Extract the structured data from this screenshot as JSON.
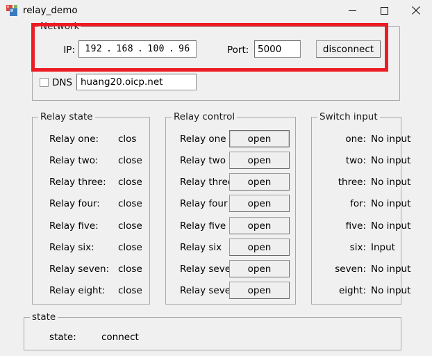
{
  "window": {
    "title": "relay_demo",
    "icon": "app-icon",
    "controls": {
      "minimize": "minimize-icon",
      "maximize": "maximize-icon",
      "close": "close-icon"
    }
  },
  "highlight": {
    "color": "#ed1c24"
  },
  "network": {
    "title": "Network",
    "ip_label": "IP:",
    "ip_octets": [
      "192",
      "168",
      "100",
      "96"
    ],
    "ip_separator": ".",
    "ip_value": "192.168.100.96",
    "port_label": "Port:",
    "port_value": "5000",
    "connect_button": "disconnect",
    "dns_label": "DNS",
    "dns_checked": false,
    "dns_value": "huang20.oicp.net"
  },
  "relay_state": {
    "title": "Relay state",
    "rows": [
      {
        "name": "Relay one:",
        "value": "clos"
      },
      {
        "name": "Relay two:",
        "value": "close"
      },
      {
        "name": "Relay three:",
        "value": "close"
      },
      {
        "name": "Relay four:",
        "value": "close"
      },
      {
        "name": "Relay five:",
        "value": "close"
      },
      {
        "name": "Relay six:",
        "value": "close"
      },
      {
        "name": "Relay seven:",
        "value": "close"
      },
      {
        "name": "Relay eight:",
        "value": "close"
      }
    ]
  },
  "relay_control": {
    "title": "Relay control",
    "rows": [
      {
        "name": "Relay one",
        "button": "open"
      },
      {
        "name": "Relay two",
        "button": "open"
      },
      {
        "name": "Relay three",
        "button": "open"
      },
      {
        "name": "Relay four",
        "button": "open"
      },
      {
        "name": "Relay five",
        "button": "open"
      },
      {
        "name": "Relay six",
        "button": "open"
      },
      {
        "name": "Relay seven",
        "button": "open"
      },
      {
        "name": "Relay seven",
        "button": "open"
      }
    ]
  },
  "switch_input": {
    "title": "Switch input",
    "rows": [
      {
        "name": "one:",
        "value": "No input"
      },
      {
        "name": "two:",
        "value": "No input"
      },
      {
        "name": "three:",
        "value": "No input"
      },
      {
        "name": "for:",
        "value": "No input"
      },
      {
        "name": "five:",
        "value": "No input"
      },
      {
        "name": "six:",
        "value": "Input"
      },
      {
        "name": "seven:",
        "value": "No input"
      },
      {
        "name": "eight:",
        "value": "No input"
      }
    ]
  },
  "state": {
    "title": "state",
    "label": "state:",
    "value": "connect"
  }
}
